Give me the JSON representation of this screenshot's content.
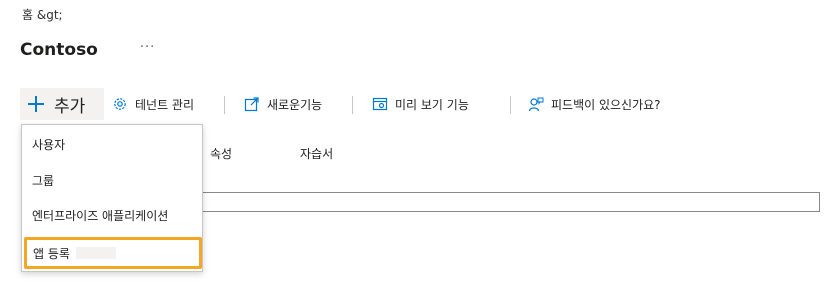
{
  "breadcrumb": {
    "home": "홈 &gt;"
  },
  "header": {
    "title": "Contoso",
    "more": "···"
  },
  "toolbar": {
    "add_label": "추가",
    "tenant_label": "테넌트 관리",
    "new_features_label": "새로운기능",
    "preview_label": "미리 보기 기능",
    "feedback_label": "피드백이 있으신가요?"
  },
  "tabs": {
    "properties": "속성",
    "tutorials": "자습서"
  },
  "add_menu": {
    "items": [
      "사용자",
      "그룹",
      "엔터프라이즈 애플리케이션",
      "앱 등록"
    ]
  },
  "colors": {
    "accent": "#0078d4",
    "highlight": "#f5a623"
  }
}
